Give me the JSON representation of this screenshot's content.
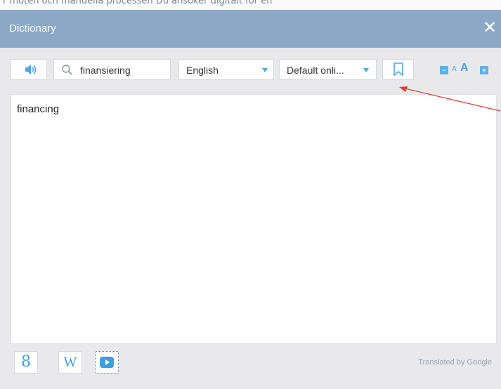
{
  "background": {
    "document_text": "r möten och manuella processen Du ansöker digitalt för en"
  },
  "panel": {
    "title": "Dictionary",
    "close_label": "✕"
  },
  "toolbar": {
    "search_value": "finansiering",
    "language": "English",
    "source": "Default onli...",
    "font_small": "A",
    "font_large": "A",
    "zoom_out": "−",
    "zoom_in": "+"
  },
  "content": {
    "result": "financing"
  },
  "footer": {
    "google": "8",
    "wiki": "W",
    "credit": "Translated by Google"
  },
  "colors": {
    "titlebar": "#8ba8c6",
    "accent": "#4aa7e3",
    "annotation": "#e53935"
  },
  "icons": {
    "speaker": "speaker-icon",
    "search": "search-icon",
    "bookmark": "bookmark-icon",
    "youtube": "youtube-icon"
  }
}
